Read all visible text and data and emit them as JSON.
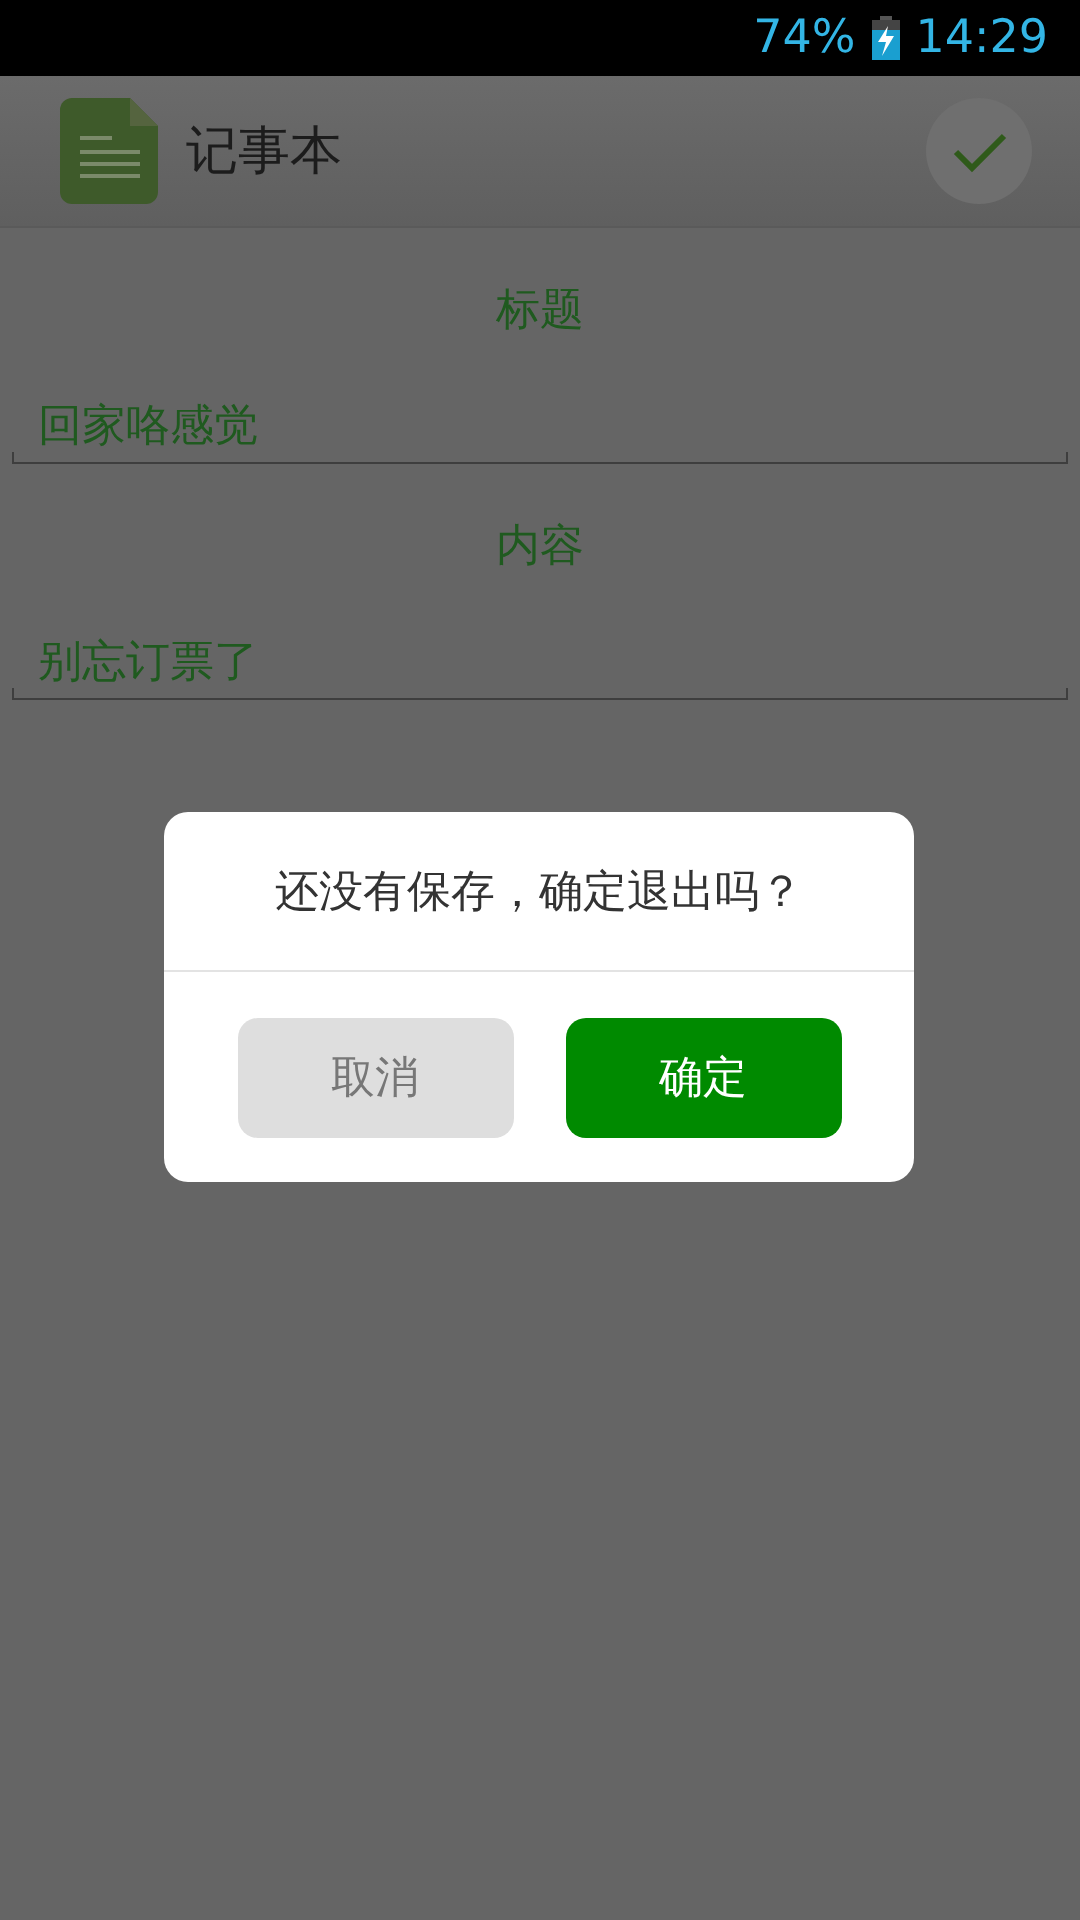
{
  "status_bar": {
    "battery": "74%",
    "time": "14:29"
  },
  "app_bar": {
    "title": "记事本"
  },
  "fields": [
    {
      "label": "标题",
      "value": "回家咯感觉"
    },
    {
      "label": "内容",
      "value": "别忘订票了"
    }
  ],
  "dialog": {
    "message": "还没有保存，确定退出吗？",
    "buttons": [
      {
        "label": "取消",
        "kind": "secondary"
      },
      {
        "label": "确定",
        "kind": "primary"
      }
    ]
  }
}
